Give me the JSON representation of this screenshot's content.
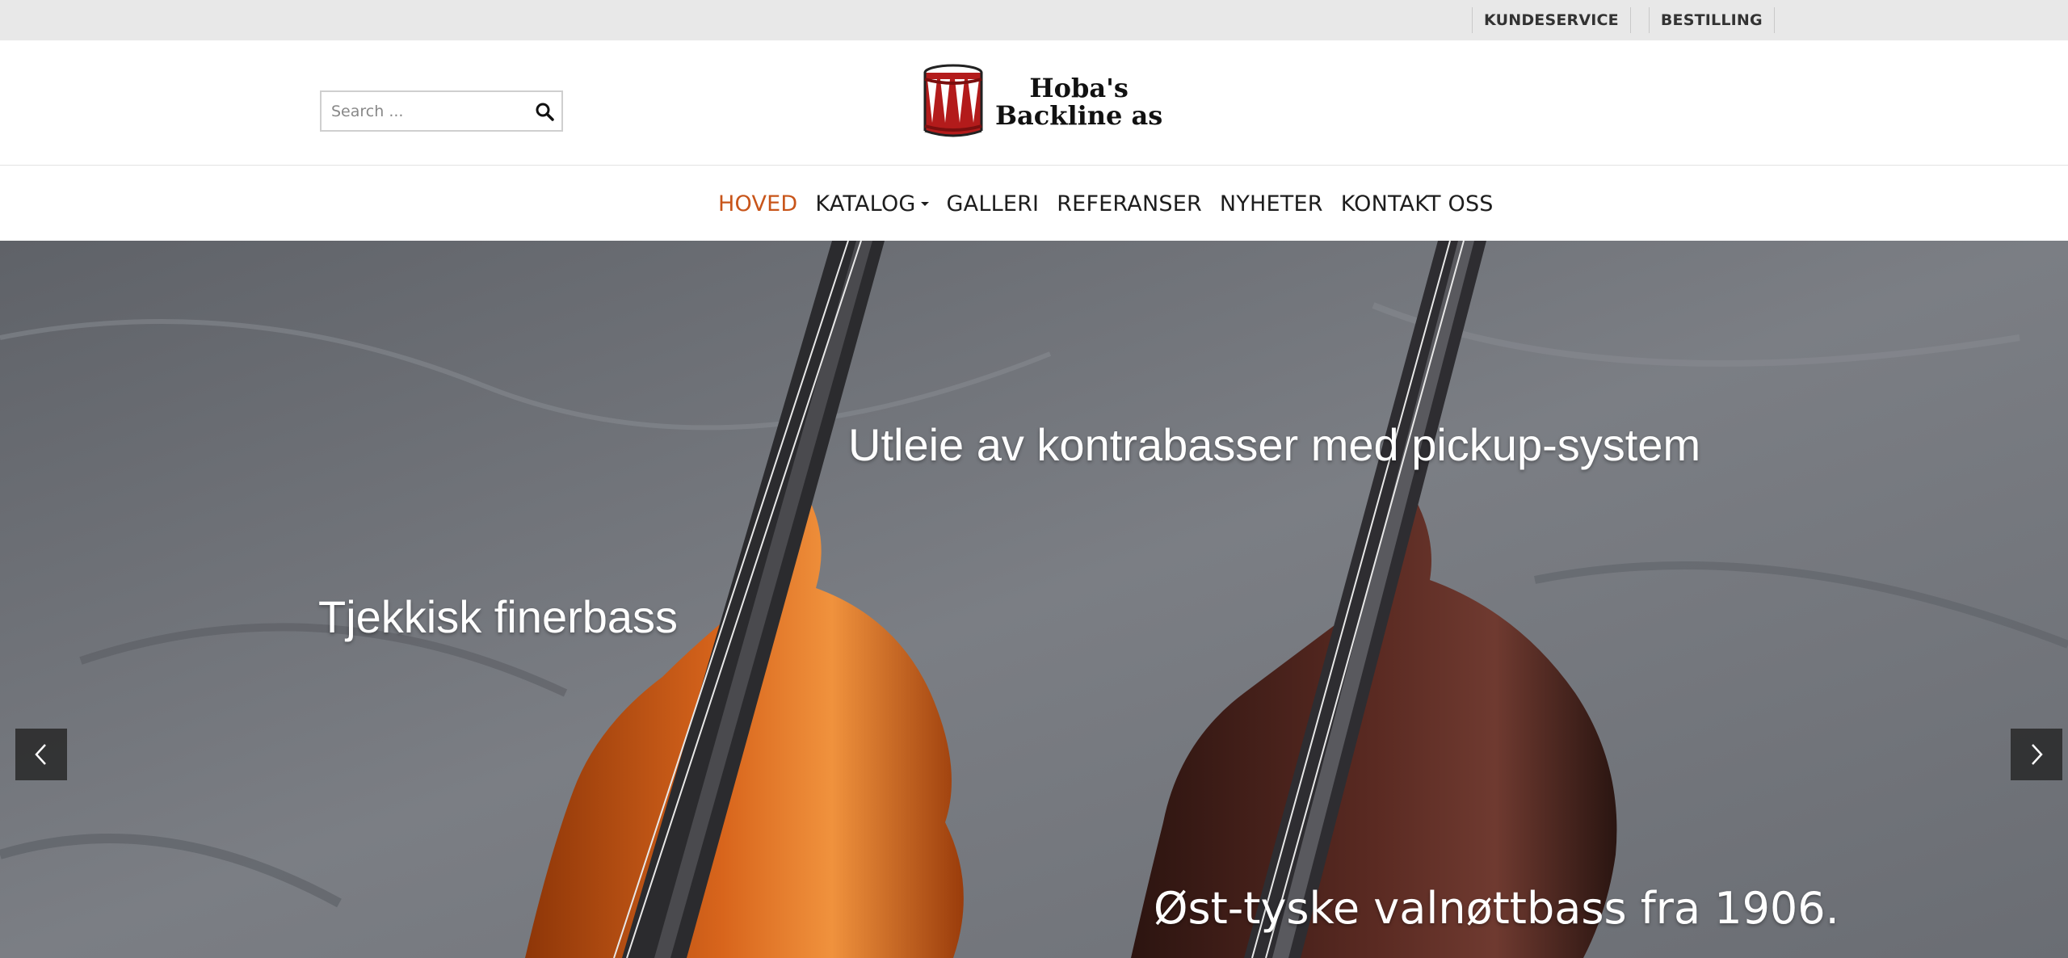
{
  "topbar": {
    "links": [
      {
        "label": "KUNDESERVICE"
      },
      {
        "label": "BESTILLING"
      }
    ]
  },
  "search": {
    "placeholder": "Search ...",
    "icon": "search-icon"
  },
  "logo": {
    "line1": "Hoba's",
    "line2": "Backline as",
    "icon": "drum-icon"
  },
  "nav": {
    "items": [
      {
        "label": "HOVED",
        "active": true
      },
      {
        "label": "KATALOG",
        "dropdown": true
      },
      {
        "label": "GALLERI"
      },
      {
        "label": "REFERANSER"
      },
      {
        "label": "NYHETER"
      },
      {
        "label": "KONTAKT OSS"
      }
    ]
  },
  "hero": {
    "captions": [
      "Utleie av kontrabasser med pickup-system",
      "Tjekkisk finerbass",
      "Øst-tyske valnøttbass fra 1906."
    ],
    "prev_icon": "chevron-left-icon",
    "next_icon": "chevron-right-icon"
  },
  "colors": {
    "topbar_bg": "#e8e8e8",
    "nav_active": "#c8551a",
    "drum_red": "#b31b1b"
  }
}
